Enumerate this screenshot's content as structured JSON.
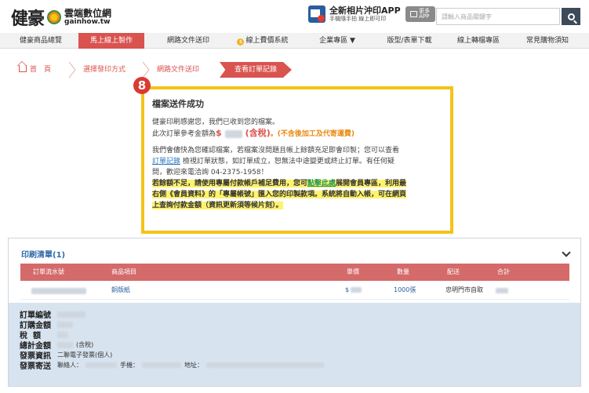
{
  "header": {
    "logo_mark": "健豪",
    "logo_cn": "雲端數位網",
    "logo_en": "gainhow.tw",
    "promo_title": "全新相片沖印APP",
    "promo_sub": "手機隨手拍 線上即可印",
    "app_badge_line1": "更多",
    "app_badge_line2": "APP",
    "search_placeholder": "請輸入商品關鍵字"
  },
  "nav": {
    "items": [
      {
        "label": "健豪商品總覽"
      },
      {
        "label": "馬上線上製作"
      },
      {
        "label": "網路文件送印"
      },
      {
        "label": "線上費價系統"
      },
      {
        "label": "企業專區 ▼"
      },
      {
        "label": "版型/表單下載"
      },
      {
        "label": "線上轉檔專區"
      },
      {
        "label": "常見購物須知"
      }
    ],
    "coin_symbol": "$"
  },
  "breadcrumb": {
    "home": "首　頁",
    "step1": "選擇發印方式",
    "step2": "網路文件送印",
    "current": "查看訂單記錄"
  },
  "step_badge": "8",
  "success": {
    "title": "檔案送件成功",
    "p1_line1": "健豪印刷感謝您，我們已收到您的檔案。",
    "p1_line2_prefix": "此次訂單參考金額為",
    "amount_symbol": "$",
    "amount_tax": "(含稅)",
    "amount_note": "。(不含後加工及代寄運費)",
    "p2_line1": "我們會儘快為您確認檔案，若檔案沒問題且帳上餘額充足即會印製；您可以查看",
    "p2_link": "訂單記錄",
    "p2_line2_rest": " 檢視訂單狀態，如訂單成立，恕無法中途變更或終止訂單。有任何疑",
    "p2_line3": "問，歡迎來電洽詢 04-2375-1958！",
    "hl_line1_prefix": "若餘額不足，請使用專屬付款帳戶補足費用，您可",
    "hl_link": "點擊此處",
    "hl_line1_suffix": "展開會員專區，利用最",
    "hl_line2": "右側《會員資料》的「專屬帳號」匯入您的印製款項。系統將自動入帳，可在網頁",
    "hl_line3": "上查詢付款金額（資訊更新須等候片刻）。"
  },
  "print_list": {
    "title": "印刷清單(1)",
    "columns": [
      "訂單流水號",
      "商品項目",
      "單價",
      "數量",
      "配送",
      "合計"
    ],
    "rows": [
      {
        "item": "銅版紙",
        "unit_symbol": "$",
        "qty": "1000張",
        "delivery": "忠明門市自取"
      }
    ]
  },
  "order_detail": {
    "order_no_label": "訂單編號",
    "purchase_label": "訂購金額",
    "tax_label": "稅額",
    "total_label": "總計金額",
    "total_note": "(含稅)",
    "invoice_label": "發票資訊",
    "invoice_value": "二聯電子發票(個人)",
    "ship_label": "發票寄送",
    "contact_label": "聯絡人：",
    "phone_label": "手機：",
    "addr_label": "地址："
  }
}
